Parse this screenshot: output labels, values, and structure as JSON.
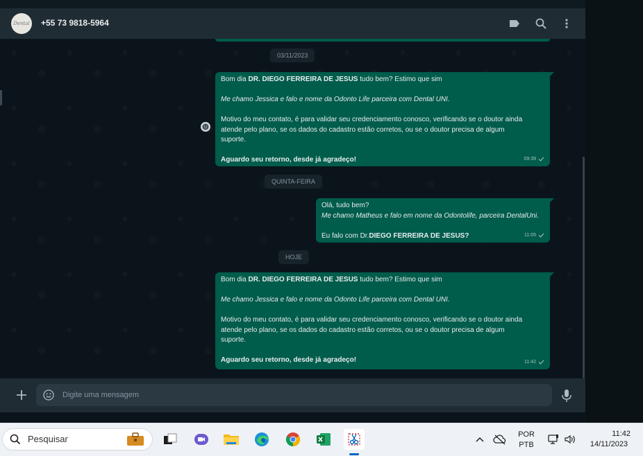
{
  "header": {
    "avatar_text": "Dental",
    "contact": "+55 73 9818-5964",
    "icons": [
      "label-icon",
      "search-icon",
      "kebab-menu-icon"
    ]
  },
  "chat": {
    "dates": [
      "03/11/2023",
      "QUINTA-FEIRA",
      "HOJE"
    ],
    "msg1": {
      "l1a": "Bom dia ",
      "l1b": "DR. DIEGO FERREIRA DE JESUS",
      "l1c": " tudo bem? Estimo que sim",
      "l2": "Me chamo Jessica e falo e nome da Odonto Life parceira com Dental UNI.",
      "l3": "Motivo do meu contato, é para validar seu credenciamento conosco, verificando se o doutor ainda",
      "l4": "atende pelo plano, se os dados do cadastro estão corretos, ou se o doutor precisa de algum",
      "l5": "suporte.",
      "l6": "Aguardo seu retorno, desde já agradeço!",
      "time": "09:39"
    },
    "msg2": {
      "l1": "Olá, tudo bem?",
      "l2": "Me chamo Matheus e falo em nome da Odontolife, parceira DentalUni.",
      "l3a": "Eu falo com Dr.",
      "l3b": "DIEGO FERREIRA DE JESUS",
      "l3c": "?",
      "time": "11:05"
    },
    "msg3": {
      "l1a": "Bom dia ",
      "l1b": "DR. DIEGO FERREIRA DE JESUS",
      "l1c": " tudo bem? Estimo que sim",
      "l2": "Me chamo Jessica e falo e nome da Odonto Life parceira com Dental UNI.",
      "l3": "Motivo do meu contato, é para validar seu credenciamento conosco, verificando se o doutor ainda",
      "l4": "atende pelo plano, se os dados do cadastro estão corretos, ou se o doutor precisa de algum",
      "l5": "suporte.",
      "l6": "Aguardo seu retorno, desde já agradeço!",
      "time": "11:42"
    }
  },
  "composer": {
    "placeholder": "Digite uma mensagem"
  },
  "taskbar": {
    "search_label": "Pesquisar",
    "lang1": "POR",
    "lang2": "PTB",
    "time": "11:42",
    "date": "14/11/2023"
  },
  "colors": {
    "bubble_out": "#005c4b",
    "header_bg": "#202c33",
    "chat_bg": "#0b141a",
    "taskbar_bg": "#eef2f7"
  }
}
